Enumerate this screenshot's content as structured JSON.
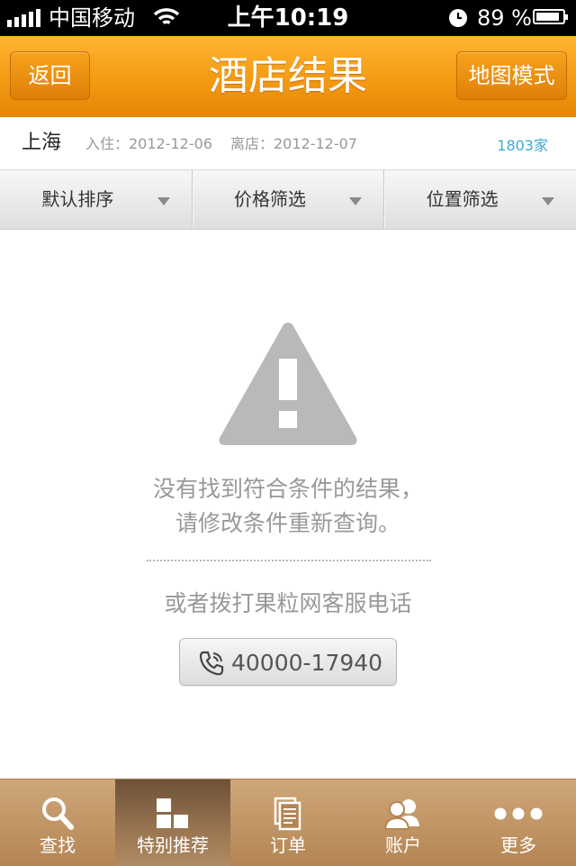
{
  "status_bar": {
    "carrier": "中国移动",
    "time": "上午10:19",
    "battery": "89 %",
    "battery_level": 0.89
  },
  "navbar": {
    "back_label": "返回",
    "title": "酒店结果",
    "map_label": "地图模式"
  },
  "info": {
    "city": "上海",
    "checkin": "入住：2012-12-06",
    "checkout": "离店：2012-12-07",
    "count": "1803家"
  },
  "filters": [
    {
      "label": "默认排序"
    },
    {
      "label": "价格筛选"
    },
    {
      "label": "位置筛选"
    }
  ],
  "empty_state": {
    "icon": "warning-icon",
    "line1": "没有找到符合条件的结果，",
    "line2": "请修改条件重新查询。",
    "hint": "或者拨打果粒网客服电话",
    "phone": "40000-17940"
  },
  "tabs": [
    {
      "label": "查找",
      "icon": "search-icon"
    },
    {
      "label": "特别推荐",
      "icon": "grid-icon",
      "active": true
    },
    {
      "label": "订单",
      "icon": "orders-icon"
    },
    {
      "label": "账户",
      "icon": "account-icon"
    },
    {
      "label": "更多",
      "icon": "more-icon"
    }
  ],
  "colors": {
    "navbar": "#f39a12",
    "link": "#3ea9d6",
    "tabbar": "#b48553"
  }
}
